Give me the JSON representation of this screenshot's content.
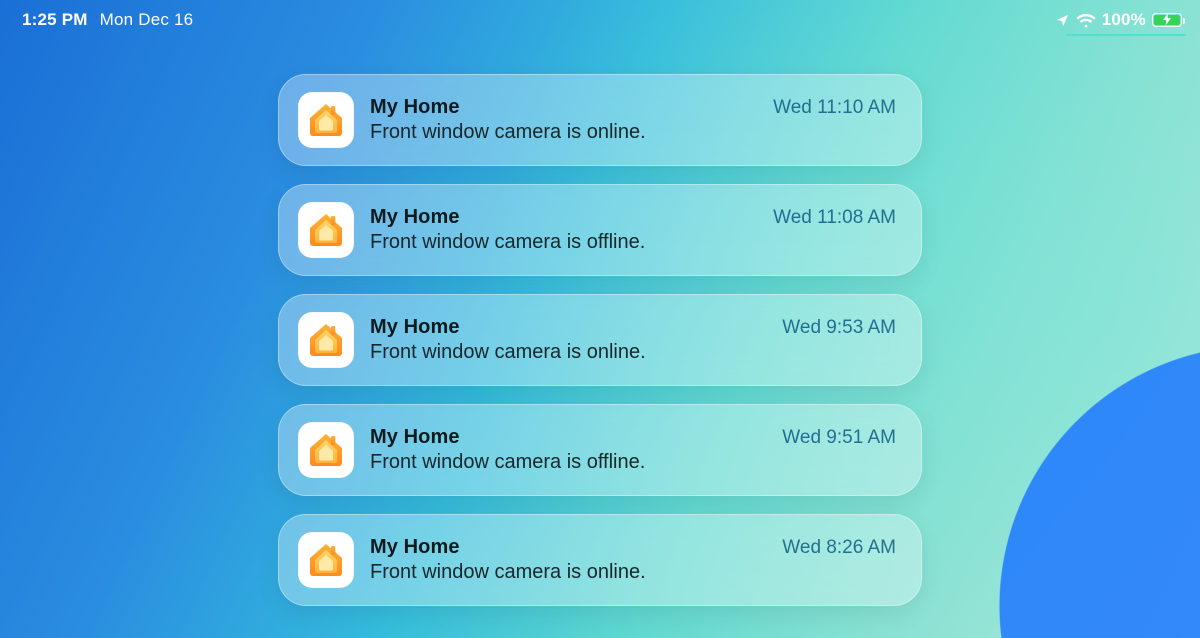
{
  "status": {
    "time": "1:25 PM",
    "date": "Mon Dec 16",
    "battery_pct": "100%",
    "charging": true
  },
  "notifications": [
    {
      "app": "My Home",
      "time": "Wed 11:10 AM",
      "body": "Front window camera is online."
    },
    {
      "app": "My Home",
      "time": "Wed 11:08 AM",
      "body": "Front window camera is offline."
    },
    {
      "app": "My Home",
      "time": "Wed 9:53 AM",
      "body": "Front window camera is online."
    },
    {
      "app": "My Home",
      "time": "Wed 9:51 AM",
      "body": "Front window camera is offline."
    },
    {
      "app": "My Home",
      "time": "Wed 8:26 AM",
      "body": "Front window camera is online."
    }
  ],
  "app_icon": "home-icon"
}
